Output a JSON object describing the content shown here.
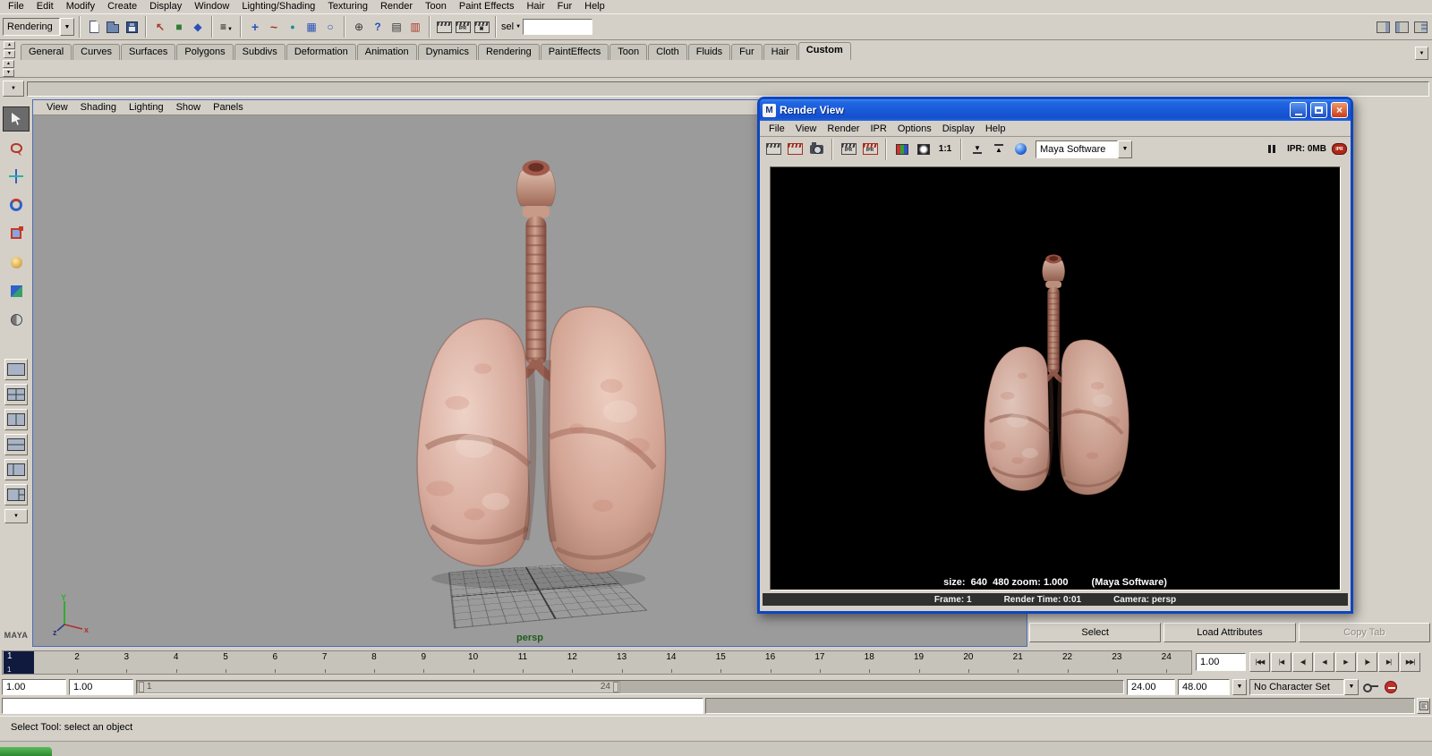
{
  "menubar": {
    "items": [
      "File",
      "Edit",
      "Modify",
      "Create",
      "Display",
      "Window",
      "Lighting/Shading",
      "Texturing",
      "Render",
      "Toon",
      "Paint Effects",
      "Hair",
      "Fur",
      "Help"
    ]
  },
  "statusline": {
    "menu_set": "Rendering",
    "sel_label": "sel",
    "quick_select_value": "",
    "ipr_tag": "IPR"
  },
  "shelf": {
    "tabs": [
      "General",
      "Curves",
      "Surfaces",
      "Polygons",
      "Subdivs",
      "Deformation",
      "Animation",
      "Dynamics",
      "Rendering",
      "PaintEffects",
      "Toon",
      "Cloth",
      "Fluids",
      "Fur",
      "Hair",
      "Custom"
    ],
    "active_tab": "Custom"
  },
  "panel_menu": {
    "items": [
      "View",
      "Shading",
      "Lighting",
      "Show",
      "Panels"
    ]
  },
  "viewport": {
    "camera_label": "persp",
    "logo": "MAYA",
    "axis": {
      "x": "x",
      "y": "Y",
      "z": "z"
    }
  },
  "render_view": {
    "title": "Render View",
    "menu": [
      "File",
      "View",
      "Render",
      "IPR",
      "Options",
      "Display",
      "Help"
    ],
    "renderer_combo": "Maya Software",
    "actual_size_label": "1:1",
    "ipr_tag": "IPR",
    "ipr_memory": "IPR: 0MB",
    "size_line": "size:  640  480 zoom: 1.000",
    "renderer_note": "(Maya Software)",
    "frame_label": "Frame: 1",
    "render_time_label": "Render Time: 0:01",
    "camera_label": "Camera: persp"
  },
  "attribute_editor": {
    "select_button": "Select",
    "load_attributes_button": "Load Attributes",
    "copy_tab_button": "Copy Tab"
  },
  "time_slider": {
    "frames": [
      "1",
      "2",
      "3",
      "4",
      "5",
      "6",
      "7",
      "8",
      "9",
      "10",
      "11",
      "12",
      "13",
      "14",
      "15",
      "16",
      "17",
      "18",
      "19",
      "20",
      "21",
      "22",
      "23",
      "24"
    ],
    "current_frame": "1",
    "current_time": "1.00",
    "transport": [
      "|◀◀",
      "|◀",
      "◀|",
      "◀",
      "▶",
      "|▶",
      "▶|",
      "▶▶|"
    ]
  },
  "range_slider": {
    "anim_start": "1.00",
    "playback_start": "1.00",
    "range_start": "1",
    "range_end": "24",
    "playback_end": "24.00",
    "anim_end": "48.00",
    "character_set": "No Character Set"
  },
  "command_line": {
    "input": "",
    "result": ""
  },
  "help_line": {
    "text": "Select Tool: select an object"
  },
  "icons": {
    "dropdown_arrow": "▼",
    "up_arrow": "▲",
    "close": "×",
    "maya_m": "M",
    "menu_lines": "≡",
    "hierarchy": "↖",
    "object_square": "■",
    "component_diamond": "◆",
    "snap_plus": "+",
    "snap_curve": "~",
    "snap_point": "●",
    "snap_grid": "▦",
    "make_live_ring": "○",
    "history_plus": "⊕",
    "question": "?",
    "inputs_pane": "▤",
    "outputs_pane": "▥",
    "settings_box": "▣"
  },
  "colors": {
    "titlebar_blue": "#1a5ada",
    "viewport_gray": "#9b9b9b",
    "current_frame_navy": "#101a3f",
    "start_green": "#2e8a2e",
    "ipr_red": "#b02818"
  }
}
